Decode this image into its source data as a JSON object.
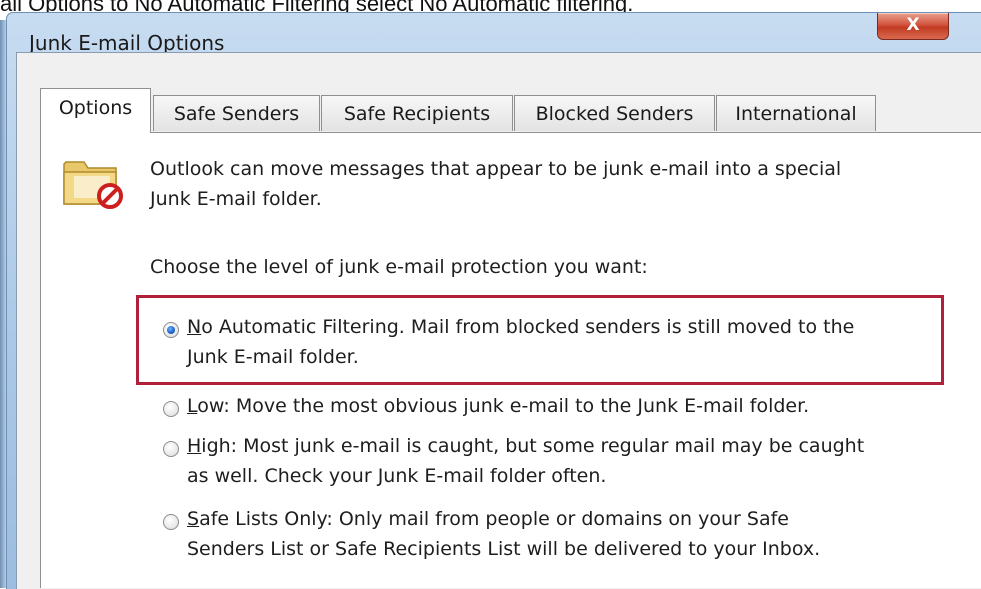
{
  "caption_text": "ail Options to No Automatic Filtering select No Automatic filtering.",
  "dialog": {
    "title": "Junk E-mail Options",
    "close_glyph": "X"
  },
  "tabs": [
    {
      "label": "Options",
      "active": true
    },
    {
      "label": "Safe Senders",
      "active": false
    },
    {
      "label": "Safe Recipients",
      "active": false
    },
    {
      "label": "Blocked Senders",
      "active": false
    },
    {
      "label": "International",
      "active": false
    }
  ],
  "intro": {
    "line1": "Outlook can move messages that appear to be junk e-mail into a special",
    "line2": "Junk E-mail folder."
  },
  "prompt": "Choose the level of junk e-mail protection you want:",
  "options": [
    {
      "key": "N",
      "line1_rest": "o Automatic Filtering. Mail from blocked senders is still moved to the",
      "line2": "Junk E-mail folder.",
      "checked": true
    },
    {
      "key": "L",
      "line1_rest": "ow: Move the most obvious junk e-mail to the Junk E-mail folder.",
      "line2": "",
      "checked": false
    },
    {
      "key": "H",
      "line1_rest": "igh: Most junk e-mail is caught, but some regular mail may be caught",
      "line2": "as well. Check your Junk E-mail folder often.",
      "checked": false
    },
    {
      "key": "S",
      "line1_rest": "afe Lists Only: Only mail from people or domains on your Safe",
      "line2": "Senders List or Safe Recipients List will be delivered to your Inbox.",
      "checked": false
    }
  ],
  "colors": {
    "highlight": "#b0203a",
    "close_button": "#c23b22",
    "radio_selected": "#1c61c7"
  },
  "icons": {
    "junk_folder": "folder-with-prohibited-sign"
  }
}
